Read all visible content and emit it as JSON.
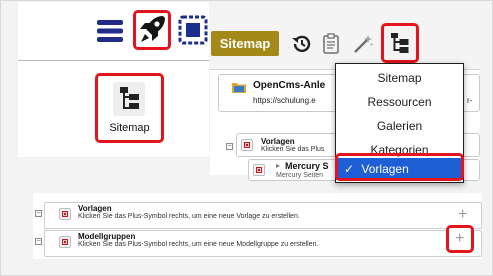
{
  "tile": {
    "label": "Sitemap"
  },
  "toolbar": {
    "active_label": "Sitemap"
  },
  "card": {
    "title": "OpenCms-Anle",
    "url_text": "https://schulung.e",
    "url_suffix": "r-"
  },
  "tree": {
    "vorlagen_title": "Vorlagen",
    "vorlagen_desc": "Klicken Sie das Plus",
    "child_title": "Mercury S",
    "child_desc": "Mercury Seiten"
  },
  "menu": {
    "items": [
      "Sitemap",
      "Ressourcen",
      "Galerien",
      "Kategorien",
      "Vorlagen"
    ],
    "checkmark": "✓"
  },
  "list": {
    "rows": [
      {
        "title": "Vorlagen",
        "desc": "Klicken Sie das Plus-Symbol rechts, um eine neue Vorlage zu erstellen.",
        "plus": "+"
      },
      {
        "title": "Modellgruppen",
        "desc": "Klicken Sie das Plus-Symbol rechts, um eine neue Modellgruppe zu erstellen.",
        "plus": "+"
      }
    ],
    "expand_glyph": "−"
  },
  "colors": {
    "highlight": "#e3141b",
    "brand": "#a38a18",
    "selection": "#1e5fd6",
    "navy": "#1d2f8c"
  }
}
